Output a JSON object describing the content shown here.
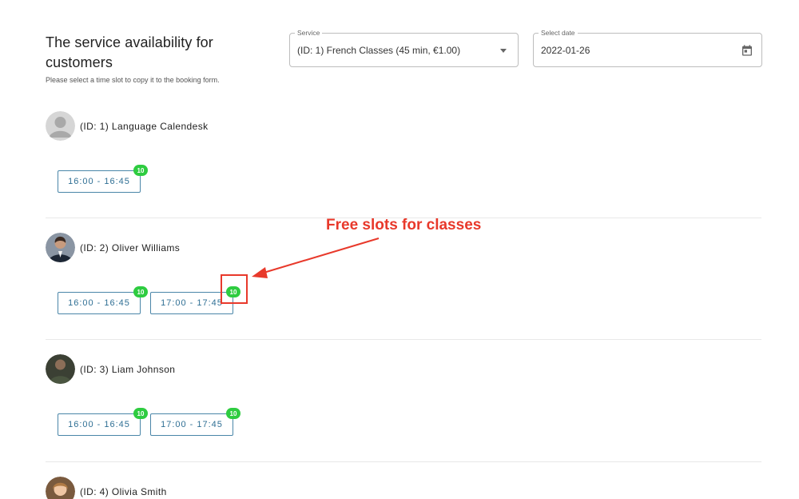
{
  "header": {
    "title": "The service availability for customers",
    "subtitle": "Please select a time slot to copy it to the booking form."
  },
  "service_field": {
    "label": "Service",
    "value": "(ID: 1) French Classes (45 min, €1.00)"
  },
  "date_field": {
    "label": "Select date",
    "value": "2022-01-26"
  },
  "employees": [
    {
      "name": "(ID: 1) Language Calendesk",
      "slots": [
        {
          "time": "16:00 - 16:45",
          "free": "10"
        }
      ]
    },
    {
      "name": "(ID: 2) Oliver Williams",
      "slots": [
        {
          "time": "16:00 - 16:45",
          "free": "10"
        },
        {
          "time": "17:00 - 17:45",
          "free": "10"
        }
      ]
    },
    {
      "name": "(ID: 3) Liam Johnson",
      "slots": [
        {
          "time": "16:00 - 16:45",
          "free": "10"
        },
        {
          "time": "17:00 - 17:45",
          "free": "10"
        }
      ]
    },
    {
      "name": "(ID: 4) Olivia Smith",
      "slots": []
    }
  ],
  "annotation": {
    "text": "Free slots for classes",
    "color": "#e8392b"
  },
  "colors": {
    "badge": "#2ecc40",
    "slot_border": "#4a86a8",
    "slot_text": "#2f6f94"
  }
}
